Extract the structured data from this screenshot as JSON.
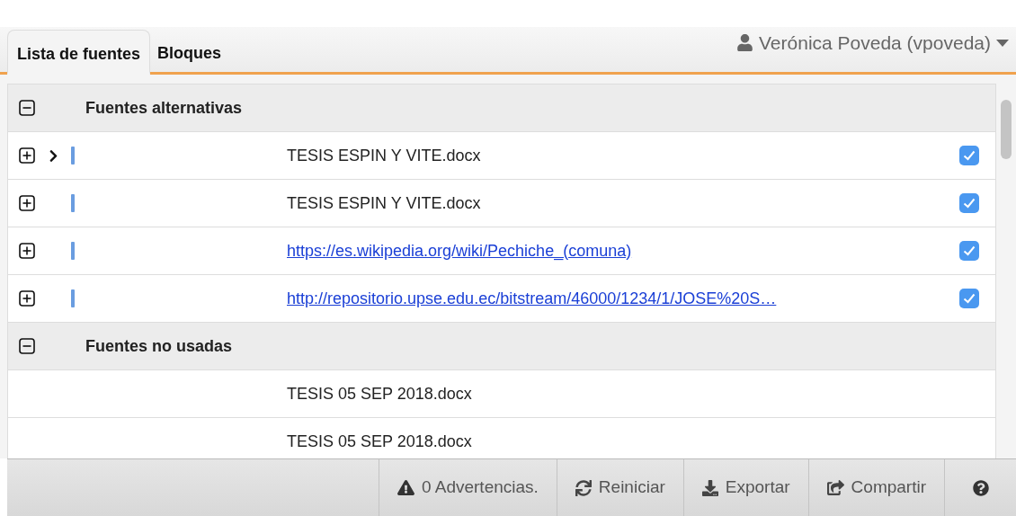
{
  "tabs": [
    {
      "label": "Lista de fuentes",
      "selected": true
    },
    {
      "label": "Bloques",
      "selected": false
    }
  ],
  "user": {
    "name": "Verónica Poveda (vpoveda)"
  },
  "groups": [
    {
      "title": "Fuentes alternativas",
      "expanded": true,
      "items": [
        {
          "kind": "text",
          "label": "TESIS ESPIN Y VITE.docx",
          "expandable": true,
          "current": true,
          "checked": true
        },
        {
          "kind": "text",
          "label": "TESIS ESPIN Y VITE.docx",
          "expandable": true,
          "current": false,
          "checked": true
        },
        {
          "kind": "link",
          "label": "https://es.wikipedia.org/wiki/Pechiche_(comuna)",
          "expandable": true,
          "current": false,
          "checked": true
        },
        {
          "kind": "link",
          "label": "http://repositorio.upse.edu.ec/bitstream/46000/1234/1/JOSE%20S…",
          "expandable": true,
          "current": false,
          "checked": true
        }
      ]
    },
    {
      "title": "Fuentes no usadas",
      "expanded": true,
      "items": [
        {
          "kind": "text",
          "label": "TESIS 05 SEP 2018.docx",
          "expandable": false,
          "current": false
        },
        {
          "kind": "text",
          "label": "TESIS 05 SEP 2018.docx",
          "expandable": false,
          "current": false
        }
      ]
    }
  ],
  "footer": [
    {
      "kind": "warning",
      "label": "0 Advertencias."
    },
    {
      "kind": "refresh",
      "label": "Reiniciar"
    },
    {
      "kind": "download",
      "label": "Exportar"
    },
    {
      "kind": "share",
      "label": "Compartir"
    },
    {
      "kind": "help"
    }
  ]
}
